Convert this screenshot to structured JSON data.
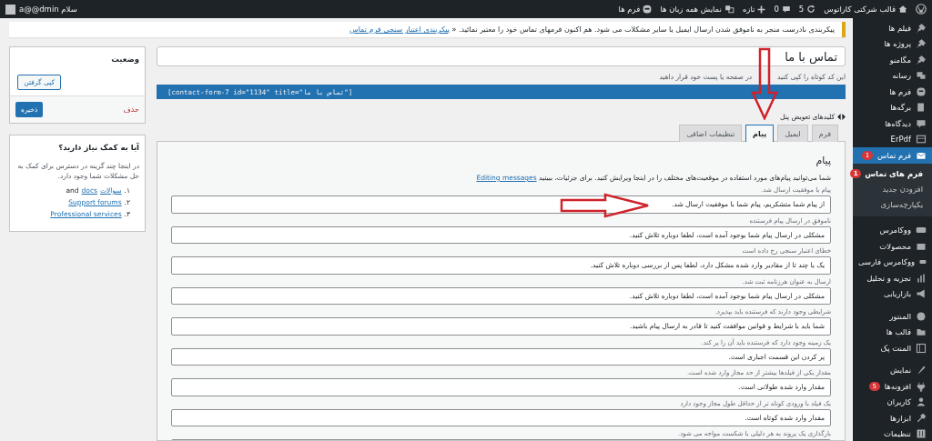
{
  "admin_bar": {
    "site": "قالب شرکتی کاراتوس",
    "updates": "5",
    "comments": "0",
    "new": "تازه",
    "languages": "نمایش همه زبان ها",
    "forms": "فرم ها",
    "greeting": "سلام a@@dmin"
  },
  "menu_groups": [
    [
      {
        "label": "فیلم ها",
        "selected": false
      },
      {
        "label": "پروژه ها",
        "selected": false
      },
      {
        "label": "مگامنو",
        "selected": false
      },
      {
        "label": "رسانه",
        "selected": false
      },
      {
        "label": "فرم ها",
        "selected": false
      },
      {
        "label": "برگه‌ها",
        "selected": false
      },
      {
        "label": "دیدگاه‌ها",
        "selected": false
      },
      {
        "label": "ErPdf",
        "selected": false
      },
      {
        "label": "فرم تماس",
        "selected": true,
        "badge": "1",
        "children": [
          {
            "label": "فرم های تماس",
            "selected": true,
            "badge": "1"
          },
          {
            "label": "افزودن جدید",
            "selected": false
          },
          {
            "label": "یکپارچه‌سازی",
            "selected": false
          }
        ]
      }
    ],
    [
      {
        "label": "ووکامرس",
        "selected": false
      },
      {
        "label": "محصولات",
        "selected": false
      },
      {
        "label": "ووکامرس فارسی",
        "selected": false
      },
      {
        "label": "تجزیه و تحلیل",
        "selected": false
      },
      {
        "label": "بازاریابی",
        "selected": false
      }
    ],
    [
      {
        "label": "المنتور",
        "selected": false
      },
      {
        "label": "قالب ها",
        "selected": false
      },
      {
        "label": "المنت پک",
        "selected": false
      }
    ],
    [
      {
        "label": "نمایش",
        "selected": false
      },
      {
        "label": "افزونه‌ها",
        "selected": false,
        "badge": "5"
      },
      {
        "label": "کاربران",
        "selected": false
      },
      {
        "label": "ابزارها",
        "selected": false
      },
      {
        "label": "تنظیمات",
        "selected": false
      }
    ]
  ],
  "notice": {
    "text": "پیکربندی نادرست منجر به ناموفق شدن ارسال ایمیل یا سایر مشکلات می شود. هم اکنون فرمهای تماس خود را معتبر نمائید. «",
    "link": "پیکربندی اعتبار سنجی فرم تماس"
  },
  "form_title": "تماس با ما",
  "shortcode_hint": [
    "این کد کوتاه را کپی کنید",
    "در صفحه یا پست خود قرار داهید"
  ],
  "shortcode": "[contact-form-7 id=\"1134\" title=\"تماس با ما\"]",
  "panel_toggle": "کلیدهای تعویض پنل",
  "tabs": [
    {
      "label": "فرم",
      "selected": false
    },
    {
      "label": "ایمیل",
      "selected": false
    },
    {
      "label": "پیام",
      "selected": true
    },
    {
      "label": "تنظیمات اضافی",
      "selected": false
    }
  ],
  "messages": {
    "heading": "پیام",
    "description": "شما می‌توانید پیام‌های مورد استفاده در موقعیت‌های مختلف را در اینجا ویرایش کنید. برای جزئیات، ببینید",
    "link": "Editing messages",
    "fields": [
      {
        "label": "پیام با موفقیت ارسال شد.",
        "value": "از پیام شما متشکریم، پیام شما با موفقیت ارسال شد."
      },
      {
        "label": "ناموفق در ارسال پیام فرستنده",
        "value": "مشکلی در ارسال پیام شما بوجود آمده است، لطفا دوباره تلاش کنید."
      },
      {
        "label": "خطای اعتبار سنجی رخ داده است",
        "value": "یک یا چند تا از مقادیر وارد شده مشکل دارد، لطفا پس از بررسی دوباره تلاش کنید."
      },
      {
        "label": "ارسال به عنوان هرزنامه ثبت شد.",
        "value": "مشکلی در ارسال پیام شما بوجود آمده است، لطفا دوباره تلاش کنید."
      },
      {
        "label": "شرایطی وجود دارند که فرستنده باید بپذیرد.",
        "value": "شما باید با شرایط و قوانین موافقت کنید تا قادر به ارسال پیام باشید."
      },
      {
        "label": "یک زمینه وجود دارد که فرستنده باید آن را پر کند.",
        "value": "پر کردن این قسمت اجباری است."
      },
      {
        "label": "مقدار یکی از فیلدها بیشتر از حد مجاز وارد شده است.",
        "value": "مقدار وارد شده طولانی است."
      },
      {
        "label": "یک فیلد با ورودی کوتاه تر از حداقل طول مجاز وجود دارد",
        "value": "مقدار وارد شده کوتاه است."
      },
      {
        "label": "بارگذاری یک پروند به هر دلیلی با شکست مواجه می شود."
      }
    ]
  },
  "status_box": {
    "title": "وضعیت",
    "copy": "کپی گرفتن",
    "delete": "حذف",
    "save": "ذخیره"
  },
  "help_box": {
    "title": "آیا به کمک نیاز دارید؟",
    "text": "در اینجا چند گزینه در دسترس برای کمک به حل مشکلات شما وجود دارد.",
    "items": [
      {
        "number": "۱.",
        "parts": [
          {
            "text": "سوالات",
            "link": true
          },
          {
            "text": "docs",
            "link": true
          },
          {
            "text": "and",
            "link": false
          }
        ]
      },
      {
        "number": "۲.",
        "parts": [
          {
            "text": "Support forums",
            "link": true
          }
        ]
      },
      {
        "number": "۳.",
        "parts": [
          {
            "text": "Professional services",
            "link": true
          }
        ]
      }
    ]
  }
}
